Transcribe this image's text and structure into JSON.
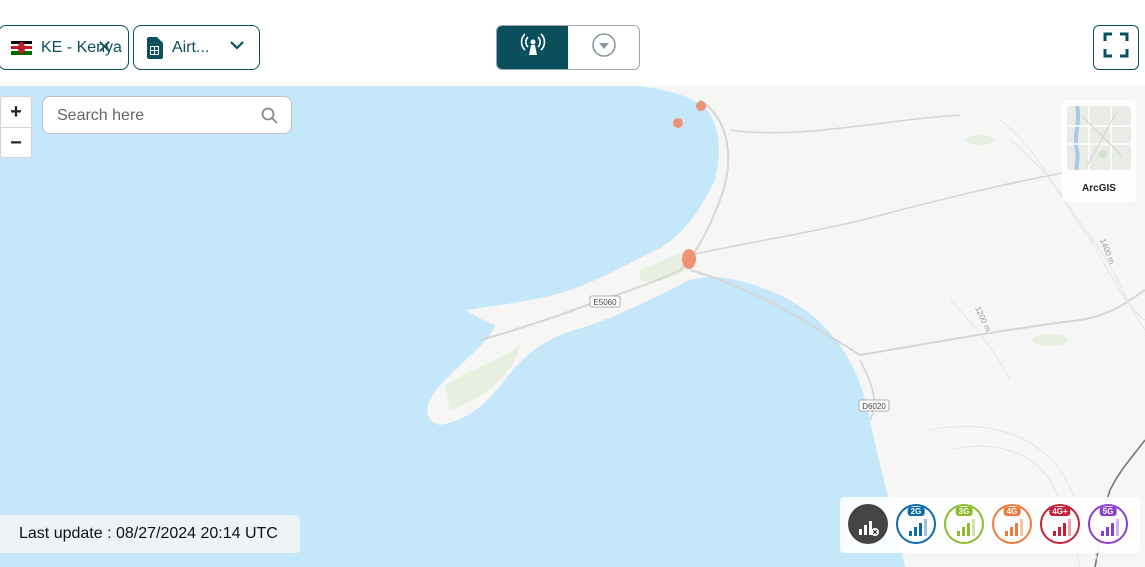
{
  "header": {
    "country": {
      "value": "KE - Kenya",
      "flag_colors": [
        "#000000",
        "#bb1f2b",
        "#006600"
      ]
    },
    "operator": {
      "value": "Airt..."
    },
    "view_toggle": {
      "options": [
        "antenna-icon",
        "heart-pin-icon"
      ],
      "active": 0
    },
    "fullscreen_icon": "fullscreen-icon"
  },
  "map": {
    "search_placeholder": "Search here",
    "zoom_in": "+",
    "zoom_out": "−",
    "basemap_label": "ArcGIS",
    "road_labels": [
      "E5060",
      "D6020"
    ],
    "contour_labels": [
      "1400 m",
      "1200 m"
    ],
    "water_color": "#c4e7f9",
    "land_color": "#f6f6f4",
    "coverage_color": "#f08a6b"
  },
  "status": {
    "last_update": "Last update : 08/27/2024 20:14 UTC"
  },
  "technologies": [
    {
      "label": "",
      "name": "no-signal",
      "color": "#444444"
    },
    {
      "label": "2G",
      "name": "2g",
      "color": "#0d6aa8"
    },
    {
      "label": "3G",
      "name": "3g",
      "color": "#8dbb2e"
    },
    {
      "label": "4G",
      "name": "4g",
      "color": "#f07a3c"
    },
    {
      "label": "4G+",
      "name": "4g-plus",
      "color": "#c4203a"
    },
    {
      "label": "5G",
      "name": "5g",
      "color": "#8a3fd1"
    }
  ]
}
